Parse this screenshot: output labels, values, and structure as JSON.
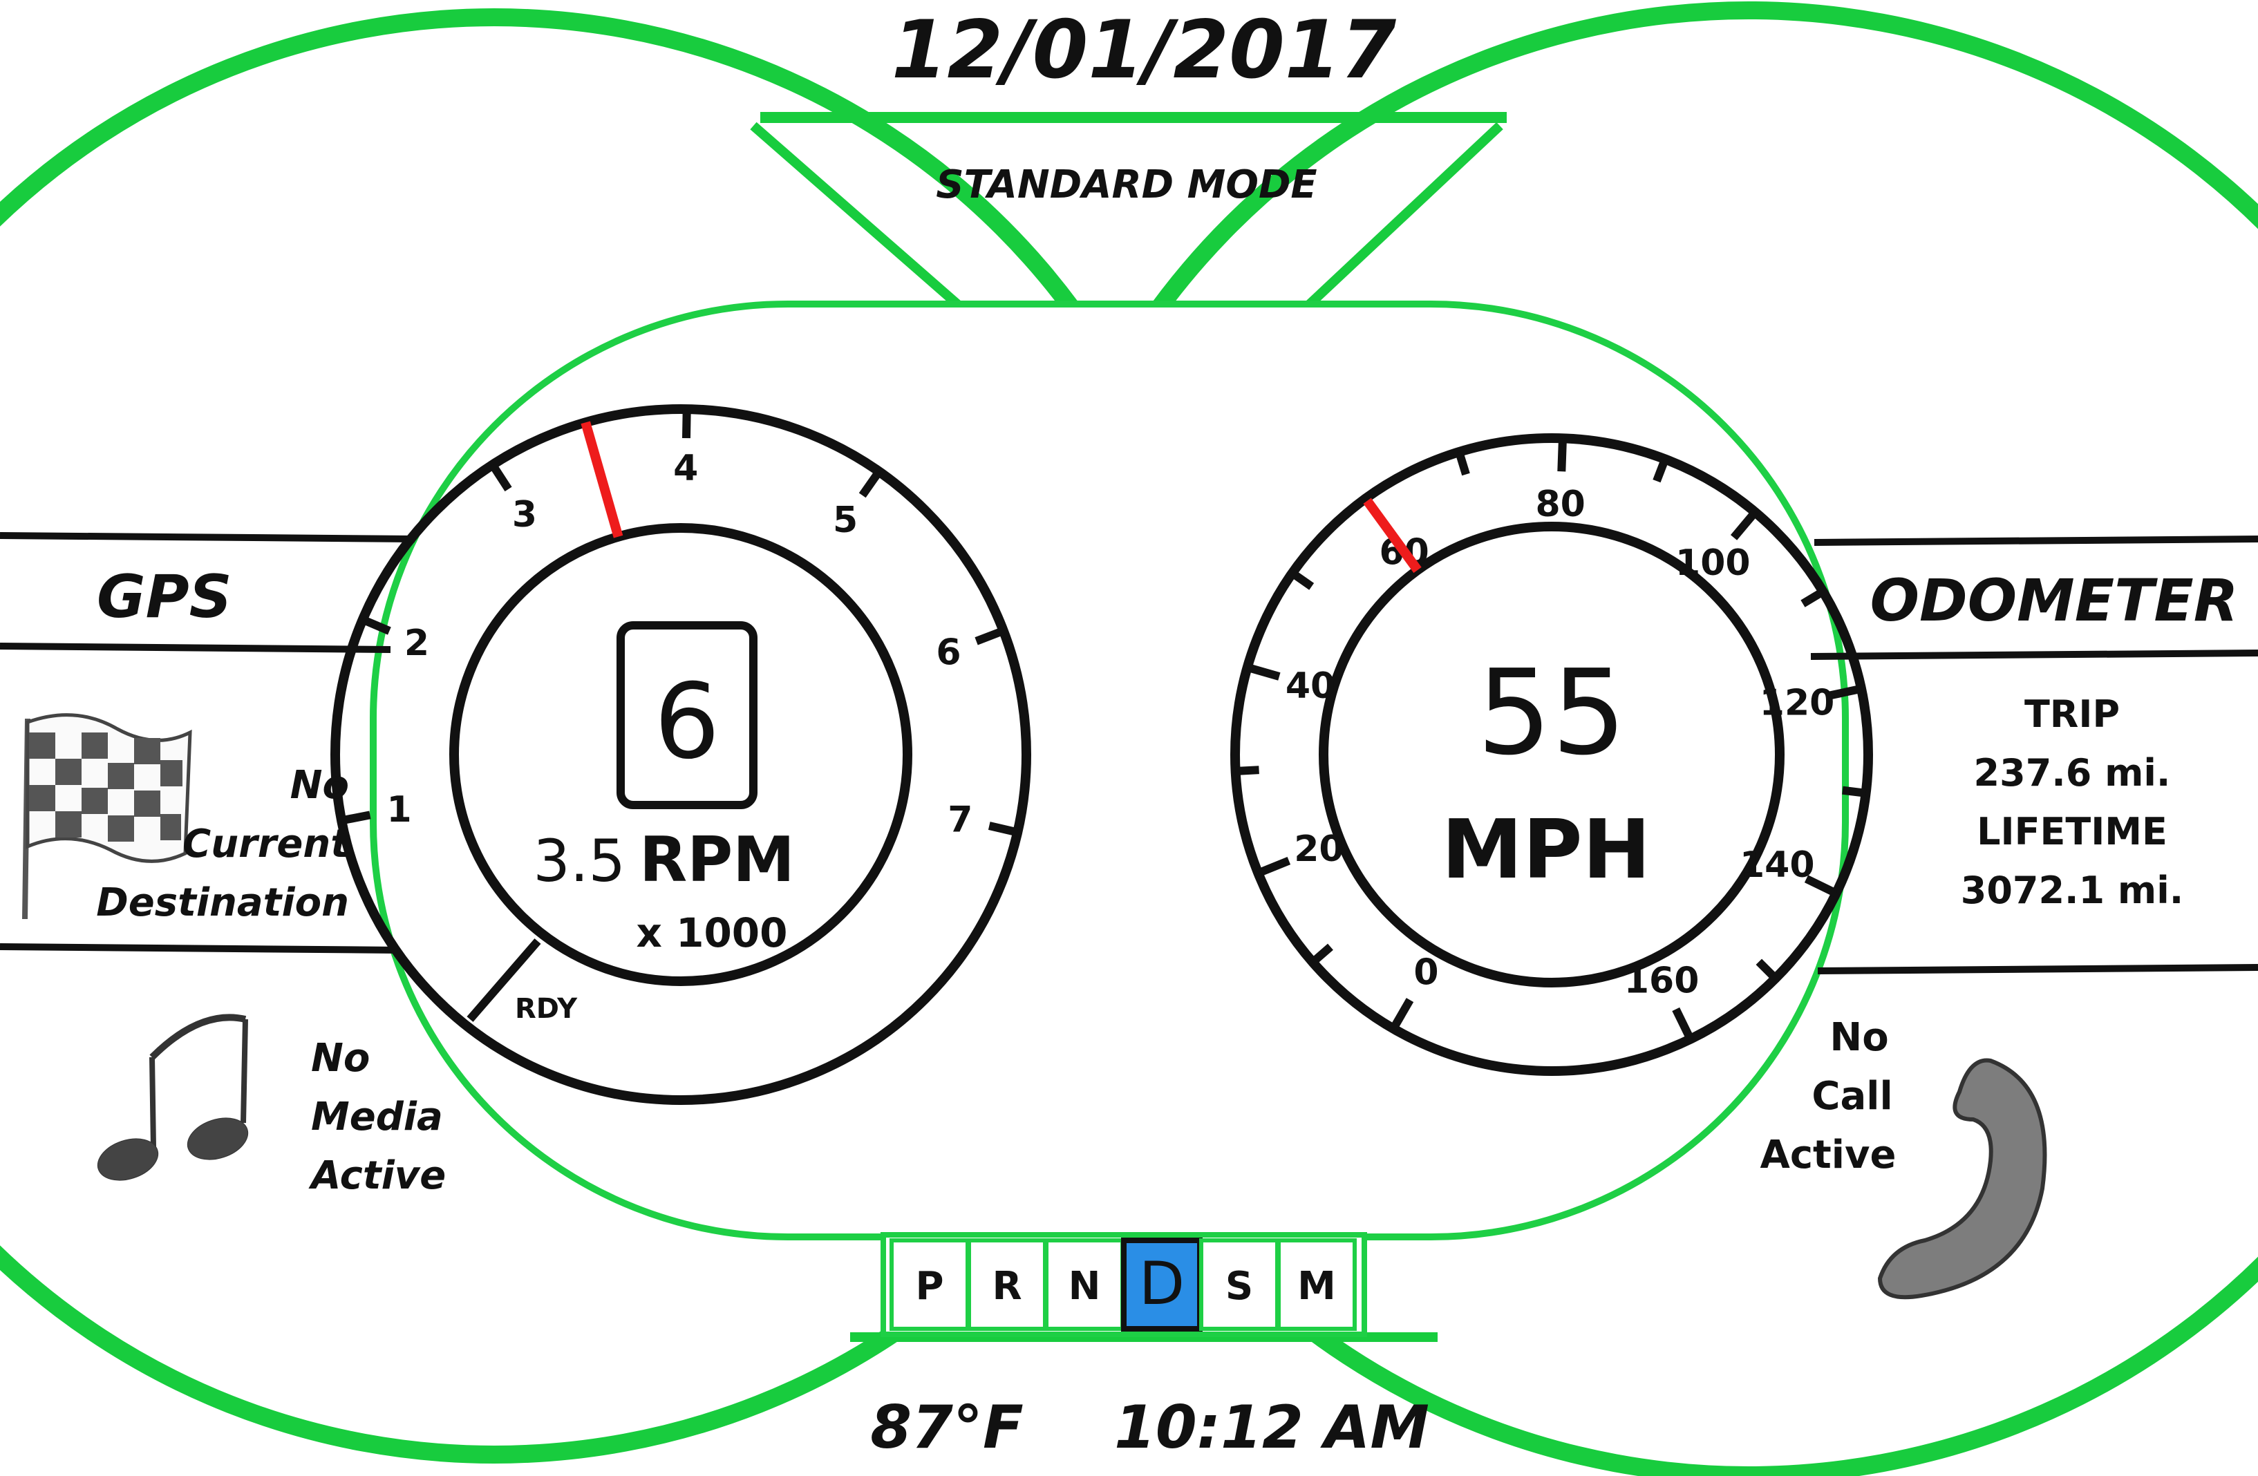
{
  "header": {
    "date": "12/01/2017",
    "mode": "STANDARD MODE"
  },
  "tachometer": {
    "gear": "6",
    "rpm_value": "3.5",
    "rpm_unit": "RPM",
    "rpm_multiplier": "x 1000",
    "status": "RDY",
    "scale_labels": [
      "1",
      "2",
      "3",
      "4",
      "5",
      "6",
      "7"
    ],
    "redline_marker_at": 3.5,
    "marker_color": "#ee1c1c"
  },
  "speedometer": {
    "speed": "55",
    "unit": "MPH",
    "scale_labels": [
      "0",
      "20",
      "40",
      "60",
      "80",
      "100",
      "120",
      "140",
      "160"
    ],
    "limit_marker_at": 60,
    "marker_color": "#ee1c1c"
  },
  "gps": {
    "title": "GPS",
    "icon": "checkered-flag-icon",
    "status_lines": [
      "No",
      "Current",
      "Destination"
    ]
  },
  "media": {
    "icon": "music-note-icon",
    "status_lines": [
      "No",
      "Media",
      "Active"
    ]
  },
  "odometer": {
    "title": "ODOMETER",
    "trip_label": "TRIP",
    "trip_value": "237.6 mi.",
    "lifetime_label": "LIFETIME",
    "lifetime_value": "3072.1 mi."
  },
  "phone": {
    "icon": "phone-handset-icon",
    "status_lines": [
      "No",
      "Call",
      "Active"
    ]
  },
  "gear_selector": {
    "options": [
      "P",
      "R",
      "N",
      "D",
      "S",
      "M"
    ],
    "selected": "D",
    "selected_color": "#2a8ee6"
  },
  "footer": {
    "temperature": "87°F",
    "time": "10:12 AM"
  },
  "colors": {
    "frame": "#18cc3e",
    "frame_thin": "#1ecf45",
    "ink": "#111111"
  }
}
